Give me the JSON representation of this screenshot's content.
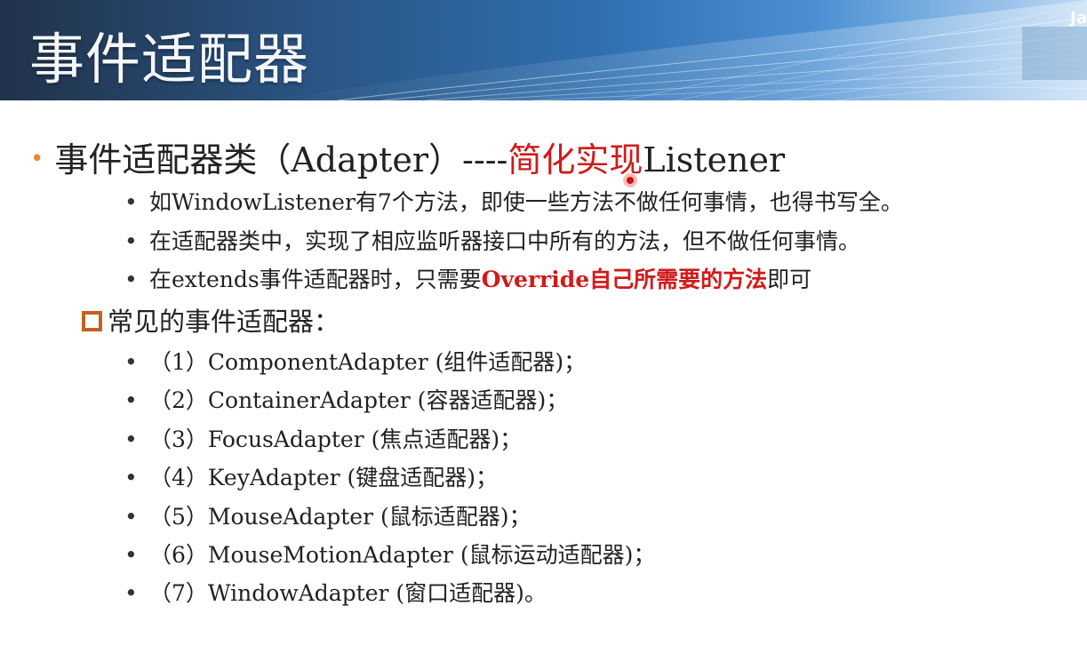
{
  "header": {
    "title": "事件适配器",
    "corner_text": "Ja"
  },
  "main_bullet": {
    "prefix": "事件适配器类（Adapter）----",
    "highlight": "简化实现",
    "suffix": "Listener"
  },
  "sub_points": [
    {
      "text": "如WindowListener有7个方法，即使一些方法不做任何事情，也得书写全。"
    },
    {
      "text": "在适配器类中，实现了相应监听器接口中所有的方法，但不做任何事情。"
    },
    {
      "before": "在extends事件适配器时，只需要",
      "highlight": "Override自己所需要的方法",
      "after": "即可"
    }
  ],
  "section": {
    "heading": "常见的事件适配器："
  },
  "adapters": [
    "（1）ComponentAdapter (组件适配器)；",
    "（2）ContainerAdapter (容器适配器)；",
    "（3）FocusAdapter (焦点适配器)；",
    "（4）KeyAdapter (键盘适配器)；",
    "（5）MouseAdapter (鼠标适配器)；",
    "（6）MouseMotionAdapter (鼠标运动适配器)；",
    "（7）WindowAdapter (窗口适配器)。"
  ],
  "colors": {
    "accent_red": "#d21a1a",
    "bullet_orange": "#e08a3a",
    "square_orange": "#c3621f"
  }
}
